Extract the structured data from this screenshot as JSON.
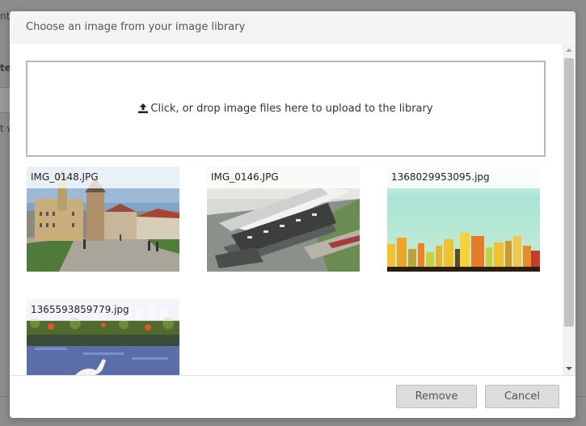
{
  "background": {
    "fragment_top": "nt",
    "fragment_mid": "te",
    "fragment_low": "t w"
  },
  "modal": {
    "title": "Choose an image from your image library"
  },
  "dropzone": {
    "icon": "upload-icon",
    "text": "Click, or drop image files here to upload to the library"
  },
  "images": [
    {
      "filename": "IMG_0148.JPG"
    },
    {
      "filename": "IMG_0146.JPG"
    },
    {
      "filename": "1368029953095.jpg"
    },
    {
      "filename": "1365593859779.jpg"
    }
  ],
  "footer": {
    "remove_label": "Remove",
    "cancel_label": "Cancel"
  },
  "colors": {
    "overlay": "#8d8d8d",
    "header_bg": "#f4f4f4",
    "button_bg": "#dcdcdc"
  }
}
